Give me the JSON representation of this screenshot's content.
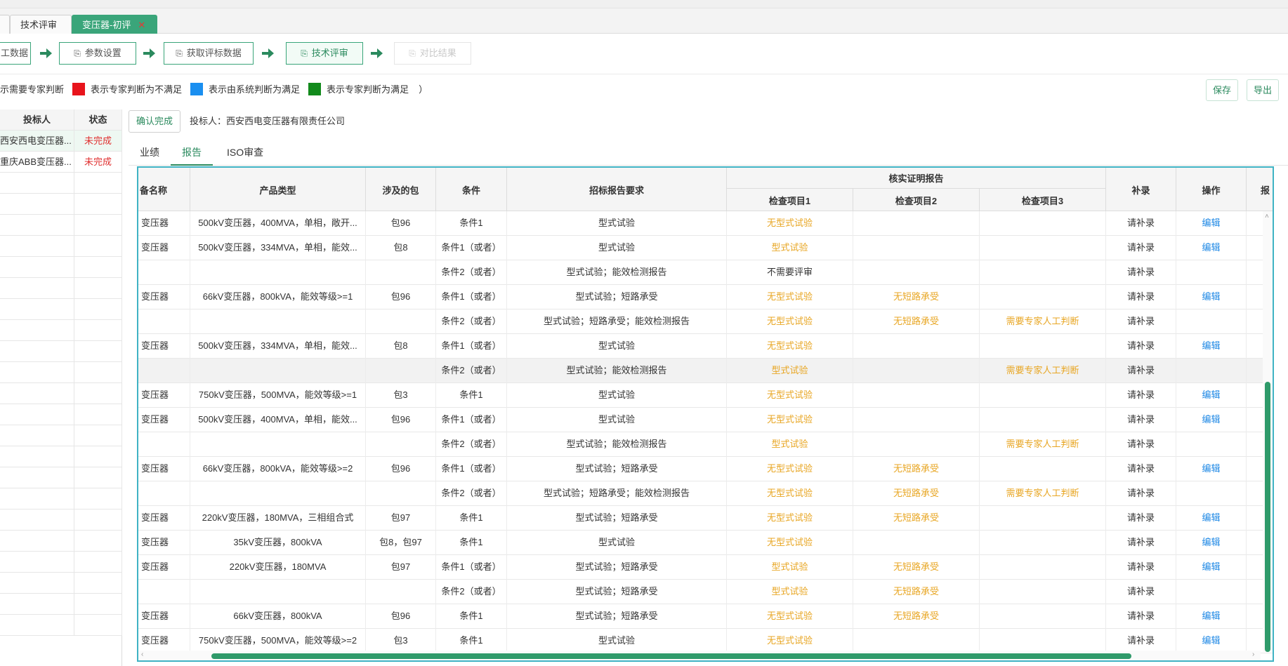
{
  "tabs": [
    {
      "label": "技术评审",
      "active": false
    },
    {
      "label": "变压器-初评",
      "active": true,
      "close": "✕"
    }
  ],
  "steps": [
    {
      "label": "工数据",
      "state": "normal"
    },
    {
      "label": "参数设置",
      "state": "normal"
    },
    {
      "label": "获取评标数据",
      "state": "normal"
    },
    {
      "label": "技术评审",
      "state": "current"
    },
    {
      "label": "对比结果",
      "state": "disabled"
    }
  ],
  "legend": {
    "prefix": "示需要专家判断",
    "items": [
      {
        "color": "#e8141c",
        "text": "表示专家判断为不满足"
      },
      {
        "color": "#1a8ff0",
        "text": "表示由系统判断为满足"
      },
      {
        "color": "#128a1c",
        "text": "表示专家判断为满足"
      }
    ],
    "suffix": "）"
  },
  "actions": {
    "save": "保存",
    "export": "导出"
  },
  "left_panel": {
    "headers": {
      "bidder": "投标人",
      "status": "状态"
    },
    "rows": [
      {
        "bidder": "西安西电变压器...",
        "status": "未完成"
      },
      {
        "bidder": "重庆ABB变压器...",
        "status": "未完成"
      }
    ]
  },
  "confirm_label": "确认完成",
  "bidder_line": "投标人：西安西电变压器有限责任公司",
  "subtabs": [
    {
      "label": "业绩",
      "active": false
    },
    {
      "label": "报告",
      "active": true
    },
    {
      "label": "ISO审查",
      "active": false
    }
  ],
  "table": {
    "headers": {
      "device_name": "备名称",
      "product_type": "产品类型",
      "package": "涉及的包",
      "condition": "条件",
      "requirement": "招标报告要求",
      "verify_group": "核实证明报告",
      "check1": "检查项目1",
      "check2": "检查项目2",
      "check3": "检查项目3",
      "supplement": "补录",
      "operation": "操作",
      "extra": "报"
    },
    "rows": [
      {
        "name": "变压器",
        "type": "500kV变压器，400MVA，单相，敞开...",
        "pkg": "包96",
        "cond": "条件1",
        "req": "型式试验",
        "c1": "无型式试验",
        "c2": "",
        "c3": "",
        "sup": "请补录",
        "op": "编辑",
        "hl": false
      },
      {
        "name": "变压器",
        "type": "500kV变压器，334MVA，单相，能效...",
        "pkg": "包8",
        "cond": "条件1（或者）",
        "req": "型式试验",
        "c1": "型式试验",
        "c2": "",
        "c3": "",
        "sup": "请补录",
        "op": "编辑",
        "hl": false
      },
      {
        "name": "",
        "type": "",
        "pkg": "",
        "cond": "条件2（或者）",
        "req": "型式试验；能效检测报告",
        "c1": "不需要评审",
        "c1_plain": true,
        "c2": "",
        "c3": "",
        "sup": "请补录",
        "op": "",
        "hl": false
      },
      {
        "name": "变压器",
        "type": "66kV变压器，800kVA，能效等级>=1",
        "pkg": "包96",
        "cond": "条件1（或者）",
        "req": "型式试验；短路承受",
        "c1": "无型式试验",
        "c2": "无短路承受",
        "c3": "",
        "sup": "请补录",
        "op": "编辑",
        "hl": false
      },
      {
        "name": "",
        "type": "",
        "pkg": "",
        "cond": "条件2（或者）",
        "req": "型式试验；短路承受；能效检测报告",
        "c1": "无型式试验",
        "c2": "无短路承受",
        "c3": "需要专家人工判断",
        "sup": "请补录",
        "op": "",
        "hl": false
      },
      {
        "name": "变压器",
        "type": "500kV变压器，334MVA，单相，能效...",
        "pkg": "包8",
        "cond": "条件1（或者）",
        "req": "型式试验",
        "c1": "无型式试验",
        "c2": "",
        "c3": "",
        "sup": "请补录",
        "op": "编辑",
        "hl": false
      },
      {
        "name": "",
        "type": "",
        "pkg": "",
        "cond": "条件2（或者）",
        "req": "型式试验；能效检测报告",
        "c1": "型式试验",
        "c2": "",
        "c3": "需要专家人工判断",
        "sup": "请补录",
        "op": "",
        "hl": true
      },
      {
        "name": "变压器",
        "type": "750kV变压器，500MVA，能效等级>=1",
        "pkg": "包3",
        "cond": "条件1",
        "req": "型式试验",
        "c1": "无型式试验",
        "c2": "",
        "c3": "",
        "sup": "请补录",
        "op": "编辑",
        "hl": false
      },
      {
        "name": "变压器",
        "type": "500kV变压器，400MVA，单相，能效...",
        "pkg": "包96",
        "cond": "条件1（或者）",
        "req": "型式试验",
        "c1": "无型式试验",
        "c2": "",
        "c3": "",
        "sup": "请补录",
        "op": "编辑",
        "hl": false
      },
      {
        "name": "",
        "type": "",
        "pkg": "",
        "cond": "条件2（或者）",
        "req": "型式试验；能效检测报告",
        "c1": "型式试验",
        "c2": "",
        "c3": "需要专家人工判断",
        "sup": "请补录",
        "op": "",
        "hl": false
      },
      {
        "name": "变压器",
        "type": "66kV变压器，800kVA，能效等级>=2",
        "pkg": "包96",
        "cond": "条件1（或者）",
        "req": "型式试验；短路承受",
        "c1": "无型式试验",
        "c2": "无短路承受",
        "c3": "",
        "sup": "请补录",
        "op": "编辑",
        "hl": false
      },
      {
        "name": "",
        "type": "",
        "pkg": "",
        "cond": "条件2（或者）",
        "req": "型式试验；短路承受；能效检测报告",
        "c1": "无型式试验",
        "c2": "无短路承受",
        "c3": "需要专家人工判断",
        "sup": "请补录",
        "op": "",
        "hl": false
      },
      {
        "name": "变压器",
        "type": "220kV变压器，180MVA，三相组合式",
        "pkg": "包97",
        "cond": "条件1",
        "req": "型式试验；短路承受",
        "c1": "无型式试验",
        "c2": "无短路承受",
        "c3": "",
        "sup": "请补录",
        "op": "编辑",
        "hl": false
      },
      {
        "name": "变压器",
        "type": "35kV变压器，800kVA",
        "pkg": "包8，包97",
        "cond": "条件1",
        "req": "型式试验",
        "c1": "无型式试验",
        "c2": "",
        "c3": "",
        "sup": "请补录",
        "op": "编辑",
        "hl": false
      },
      {
        "name": "变压器",
        "type": "220kV变压器，180MVA",
        "pkg": "包97",
        "cond": "条件1（或者）",
        "req": "型式试验；短路承受",
        "c1": "型式试验",
        "c2": "无短路承受",
        "c3": "",
        "sup": "请补录",
        "op": "编辑",
        "hl": false
      },
      {
        "name": "",
        "type": "",
        "pkg": "",
        "cond": "条件2（或者）",
        "req": "型式试验；短路承受",
        "c1": "型式试验",
        "c2": "无短路承受",
        "c3": "",
        "sup": "请补录",
        "op": "",
        "hl": false
      },
      {
        "name": "变压器",
        "type": "66kV变压器，800kVA",
        "pkg": "包96",
        "cond": "条件1",
        "req": "型式试验；短路承受",
        "c1": "无型式试验",
        "c2": "无短路承受",
        "c3": "",
        "sup": "请补录",
        "op": "编辑",
        "hl": false
      },
      {
        "name": "变压器",
        "type": "750kV变压器，500MVA，能效等级>=2",
        "pkg": "包3",
        "cond": "条件1",
        "req": "型式试验",
        "c1": "无型式试验",
        "c2": "",
        "c3": "",
        "sup": "请补录",
        "op": "编辑",
        "hl": false
      }
    ]
  },
  "colors": {
    "accent": "#3aa57a",
    "warning": "#e8a623",
    "link": "#1e88e5",
    "danger": "#e03030",
    "frame": "#3fb3c4"
  }
}
